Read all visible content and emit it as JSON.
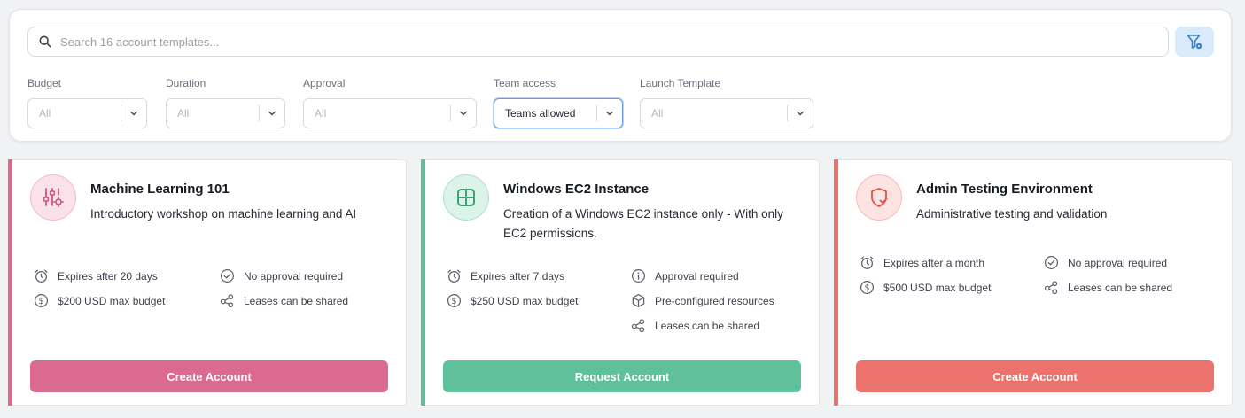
{
  "search": {
    "placeholder": "Search 16 account templates..."
  },
  "filters": [
    {
      "label": "Budget",
      "value": "All"
    },
    {
      "label": "Duration",
      "value": "All"
    },
    {
      "label": "Approval",
      "value": "All"
    },
    {
      "label": "Team access",
      "value": "Teams allowed"
    },
    {
      "label": "Launch Template",
      "value": "All"
    }
  ],
  "colors": {
    "pink": "#db6a90",
    "green": "#5ec19b",
    "red": "#ec736d",
    "filter_button_bg": "#d9ebfa",
    "filter_icon": "#3a80c8"
  },
  "cards": [
    {
      "title": "Machine Learning 101",
      "description": "Introductory workshop on machine learning and AI",
      "icon": "settings-sliders-icon",
      "features": [
        {
          "icon": "alarm-clock-icon",
          "text": "Expires after 20 days"
        },
        {
          "icon": "check-circle-icon",
          "text": "No approval required"
        },
        {
          "icon": "dollar-circle-icon",
          "text": "$200 USD max budget"
        },
        {
          "icon": "share-icon",
          "text": "Leases can be shared"
        }
      ],
      "button": "Create Account"
    },
    {
      "title": "Windows EC2 Instance",
      "description": "Creation of a Windows EC2 instance only - With only EC2 permissions.",
      "icon": "windows-grid-icon",
      "features": [
        {
          "icon": "alarm-clock-icon",
          "text": "Expires after 7 days"
        },
        {
          "icon": "info-circle-icon",
          "text": "Approval required"
        },
        {
          "icon": "dollar-circle-icon",
          "text": "$250 USD max budget"
        },
        {
          "icon": "box-icon",
          "text": "Pre-configured resources"
        },
        {
          "icon": "share-icon",
          "text": "Leases can be shared"
        }
      ],
      "button": "Request Account"
    },
    {
      "title": "Admin Testing Environment",
      "description": "Administrative testing and validation",
      "icon": "shield-check-icon",
      "features": [
        {
          "icon": "alarm-clock-icon",
          "text": "Expires after a month"
        },
        {
          "icon": "check-circle-icon",
          "text": "No approval required"
        },
        {
          "icon": "dollar-circle-icon",
          "text": "$500 USD max budget"
        },
        {
          "icon": "share-icon",
          "text": "Leases can be shared"
        }
      ],
      "button": "Create Account"
    }
  ]
}
